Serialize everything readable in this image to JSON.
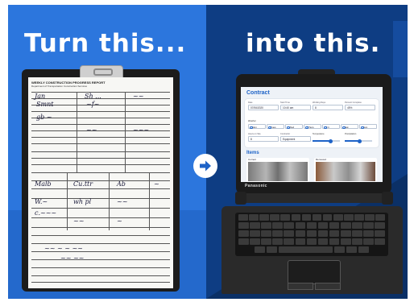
{
  "headlines": {
    "left": "Turn this...",
    "right": "into this."
  },
  "paper_form": {
    "title": "WEEKLY CONSTRUCTION PROGRESS REPORT",
    "subtitle": "Department of Transportation  Construction Services"
  },
  "tablet": {
    "brand": "Panasonic",
    "app": {
      "section_contract": "Contract",
      "fields": [
        {
          "label": "Date",
          "value": "07/06/2020"
        },
        {
          "label": "Start Time",
          "value": "10:40 am"
        },
        {
          "label": "Working Days",
          "value": "8"
        },
        {
          "label": "Percent Complete",
          "value": "45%"
        }
      ],
      "weather_label": "Weather",
      "weather_options": [
        "Mon",
        "Tues",
        "Wed",
        "Thurs",
        "Fri",
        "Sat",
        "Sun"
      ],
      "row3": [
        {
          "label": "Hours on Site",
          "value": "8"
        },
        {
          "label": "Contractor",
          "value": "Equipment"
        }
      ],
      "sliders": [
        {
          "label": "Temperature",
          "value": 0.65
        },
        {
          "label": "Precipitation",
          "value": 0.55
        }
      ],
      "section_items": "Items",
      "items": [
        {
          "label": "Current"
        },
        {
          "label": "Removed"
        }
      ]
    }
  },
  "colors": {
    "accent_blue": "#2c76dd",
    "dark_blue": "#0e3d83",
    "app_blue": "#1e63c7"
  },
  "icons": {
    "arrow": "arrow-right-circle-icon"
  }
}
